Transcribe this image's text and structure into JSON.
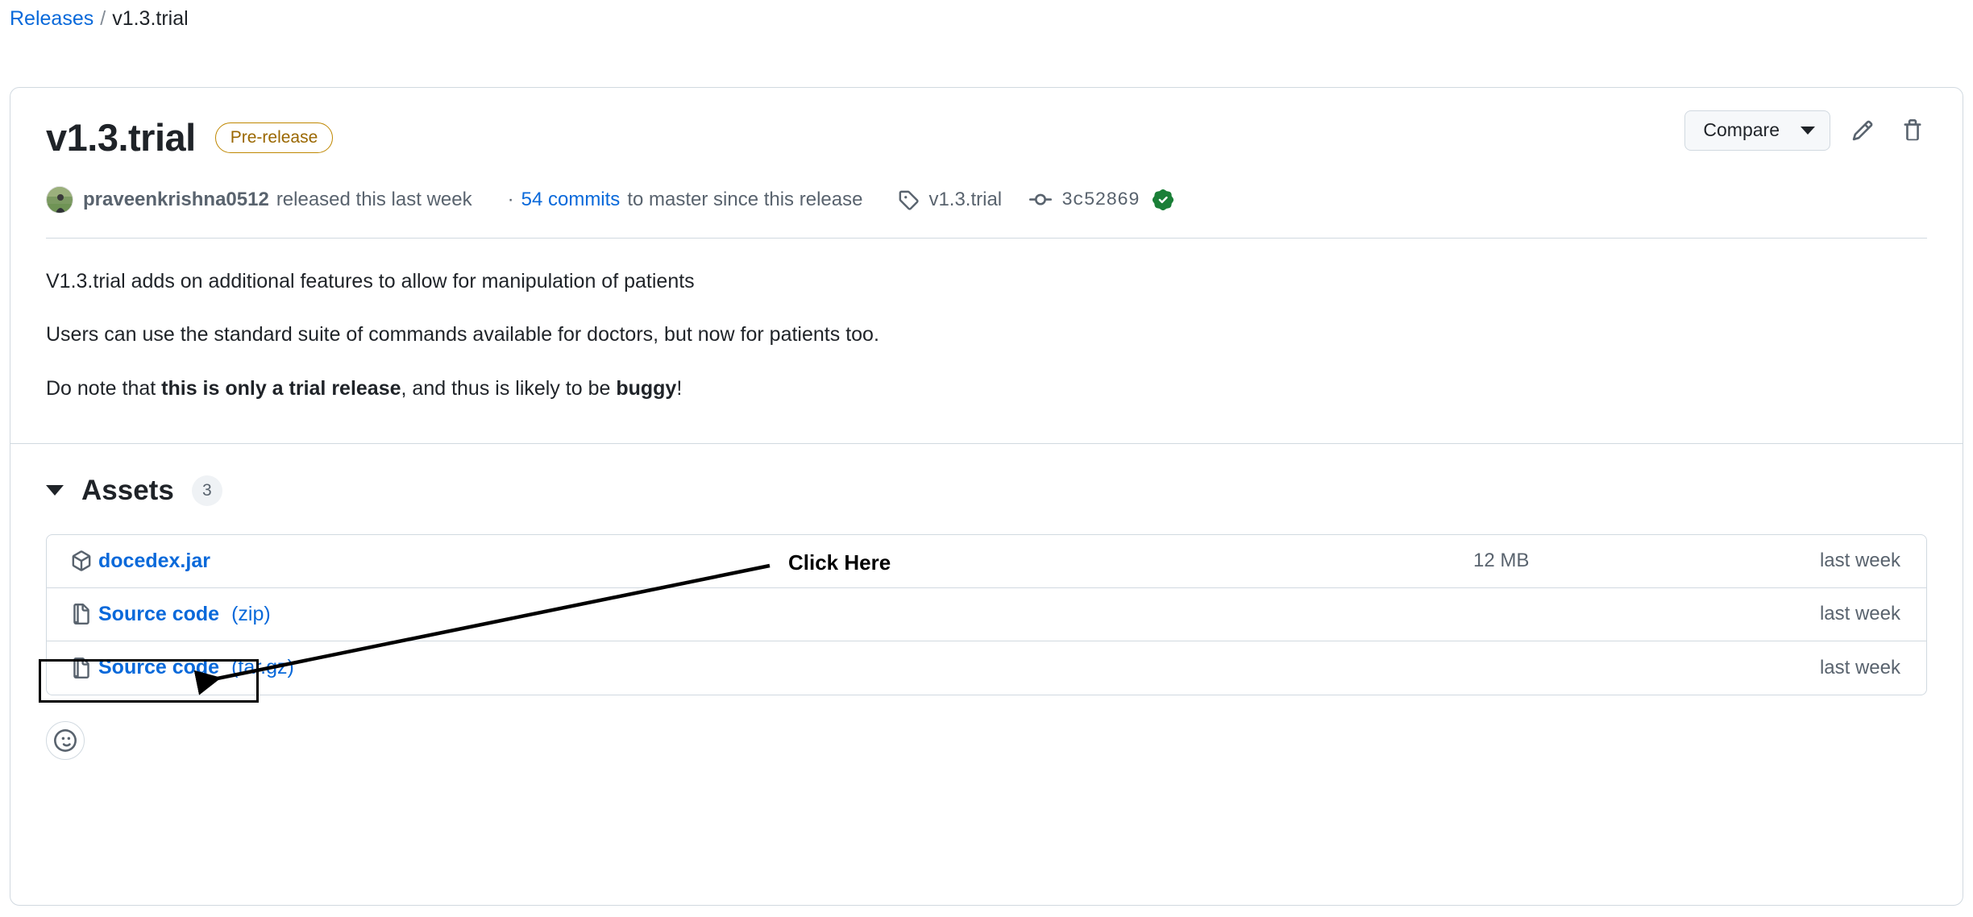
{
  "breadcrumb": {
    "parent_label": "Releases",
    "separator": "/",
    "current_label": "v1.3.trial"
  },
  "release": {
    "title": "v1.3.trial",
    "prerelease_badge": "Pre-release",
    "author": "praveenkrishna0512",
    "published_text": "released this last week",
    "separator_dot": "·",
    "commits_link": "54 commits",
    "commits_suffix": "to master since this release",
    "tag_name": "v1.3.trial",
    "commit_sha": "3c52869",
    "verified": true
  },
  "actions": {
    "compare_label": "Compare",
    "edit_icon": "pencil-icon",
    "delete_icon": "trash-icon",
    "dropdown_icon": "chevron-down-icon"
  },
  "body": {
    "paragraph1": "V1.3.trial adds on additional features to allow for manipulation of patients",
    "paragraph2": "Users can use the standard suite of commands available for doctors, but now for patients too.",
    "paragraph3_part1": "Do note that ",
    "paragraph3_bold1": "this is only a trial release",
    "paragraph3_part2": ", and thus is likely to be ",
    "paragraph3_bold2": "buggy",
    "paragraph3_part3": "!"
  },
  "assets": {
    "title": "Assets",
    "count": "3",
    "toggle_icon": "triangle-down-icon",
    "rows": [
      {
        "icon": "package-icon",
        "name": "docedex.jar",
        "suffix": "",
        "size": "12 MB",
        "date": "last week"
      },
      {
        "icon": "file-zip-icon",
        "name": "Source code",
        "suffix": "(zip)",
        "size": "",
        "date": "last week"
      },
      {
        "icon": "file-zip-icon",
        "name": "Source code",
        "suffix": "(tar.gz)",
        "size": "",
        "date": "last week"
      }
    ]
  },
  "reaction": {
    "icon": "smiley-icon"
  },
  "annotation": {
    "label": "Click Here",
    "arrow_icon": "arrow-icon",
    "highlight_target": "docedex.jar"
  },
  "colors": {
    "link_blue": "#0969da",
    "prerelease_amber": "#9a6700",
    "muted_grey": "#59636e",
    "border_grey": "#d1d9e0",
    "verified_green": "#1a7f37",
    "annotation_black": "#000000"
  }
}
